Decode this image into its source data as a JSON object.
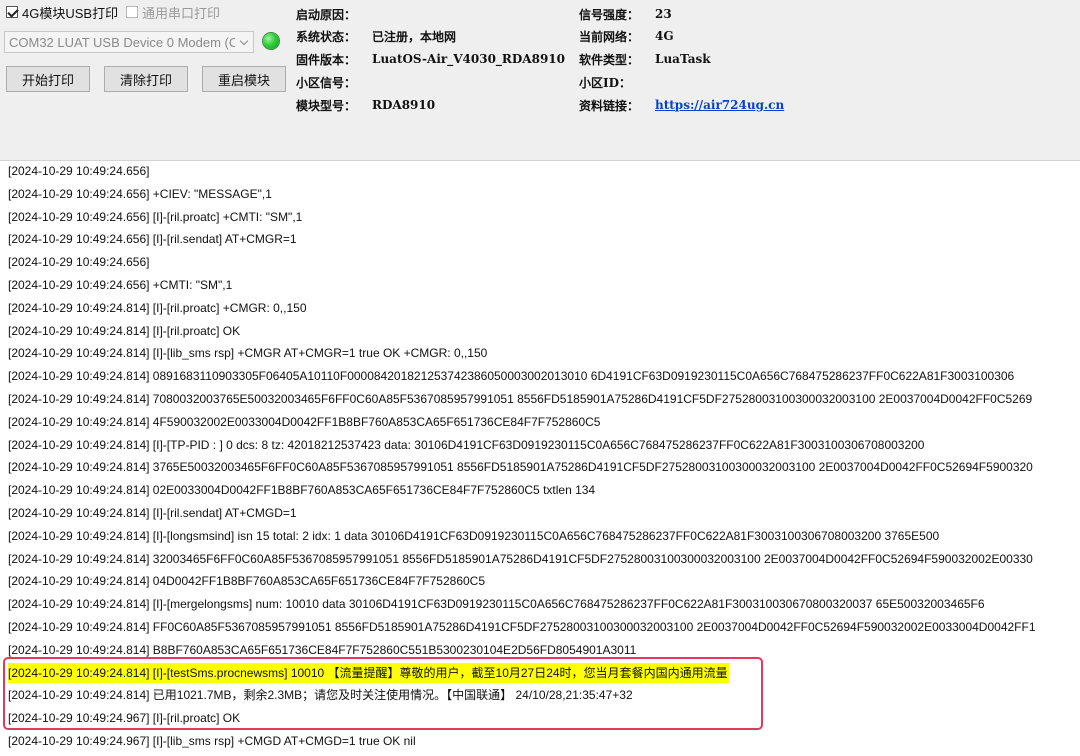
{
  "top": {
    "chk_4g": "4G模块USB打印",
    "chk_serial": "通用串口打印",
    "combo_value": "COM32 LUAT USB Device 0 Modem (C",
    "buttons": {
      "start": "开始打印",
      "clear": "清除打印",
      "restart": "重启模块"
    },
    "led_color": "#2ecf3a"
  },
  "info": {
    "boot_reason_label": "启动原因：",
    "boot_reason": "",
    "sys_status_label": "系统状态：",
    "sys_status": "已注册，本地网",
    "firmware_label": "固件版本：",
    "firmware": "LuatOS-Air_V4030_RDA8910",
    "cell_label": "小区信号：",
    "cell": "",
    "module_label": "模块型号：",
    "module": "RDA8910",
    "signal_label": "信号强度：",
    "signal": "23",
    "network_label": "当前网络：",
    "network": "4G",
    "software_label": "软件类型：",
    "software": "LuaTask",
    "cellid_label": "小区ID：",
    "cellid": "",
    "link_label": "资料链接：",
    "link": "https://air724ug.cn",
    "link_color": "#0a3fcf"
  },
  "log": [
    "[2024-10-29 10:49:24.656]",
    "[2024-10-29 10:49:24.656] +CIEV: \"MESSAGE\",1",
    "[2024-10-29 10:49:24.656] [I]-[ril.proatc] +CMTI: \"SM\",1",
    "[2024-10-29 10:49:24.656] [I]-[ril.sendat] AT+CMGR=1",
    "[2024-10-29 10:49:24.656]",
    "[2024-10-29 10:49:24.656] +CMTI: \"SM\",1",
    "[2024-10-29 10:49:24.814] [I]-[ril.proatc] +CMGR: 0,,150",
    "[2024-10-29 10:49:24.814] [I]-[ril.proatc] OK",
    "[2024-10-29 10:49:24.814] [I]-[lib_sms rsp] +CMGR AT+CMGR=1 true OK +CMGR: 0,,150",
    "[2024-10-29 10:49:24.814] 0891683110903305F06405A10110F000084201821253742386050003002013010 6D4191CF63D0919230115C0A656C768475286237FF0C622A81F3003100306",
    "[2024-10-29 10:49:24.814] 7080032003765E50032003465F6FF0C60A85F5367085957991051 8556FD5185901A75286D4191CF5DF27528003100300032003100 2E0037004D0042FF0C5269",
    "[2024-10-29 10:49:24.814] 4F590032002E0033004D0042FF1B8BF760A853CA65F651736CE84F7F752860C5",
    "[2024-10-29 10:49:24.814] [I]-[TP-PID : ] 0 dcs:  8 tz:  42018212537423 data:  30106D4191CF63D0919230115C0A656C768475286237FF0C622A81F3003100306708003200",
    "[2024-10-29 10:49:24.814] 3765E50032003465F6FF0C60A85F5367085957991051 8556FD5185901A75286D4191CF5DF27528003100300032003100 2E0037004D0042FF0C52694F5900320",
    "[2024-10-29 10:49:24.814] 02E0033004D0042FF1B8BF760A853CA65F651736CE84F7F752860C5 txtlen 134",
    "[2024-10-29 10:49:24.814] [I]-[ril.sendat] AT+CMGD=1",
    "[2024-10-29 10:49:24.814] [I]-[longsmsind] isn 15 total: 2 idx: 1 data 30106D4191CF63D0919230115C0A656C768475286237FF0C622A81F3003100306708003200 3765E500",
    "[2024-10-29 10:49:24.814] 32003465F6FF0C60A85F5367085957991051 8556FD5185901A75286D4191CF5DF27528003100300032003100 2E0037004D0042FF0C52694F590032002E00330",
    "[2024-10-29 10:49:24.814] 04D0042FF1B8BF760A853CA65F651736CE84F7F752860C5",
    "[2024-10-29 10:49:24.814] [I]-[mergelongsms] num: 10010 data 30106D4191CF63D0919230115C0A656C768475286237FF0C622A81F300310030670800320037 65E50032003465F6",
    "[2024-10-29 10:49:24.814] FF0C60A85F5367085957991051 8556FD5185901A75286D4191CF5DF27528003100300032003100 2E0037004D0042FF0C52694F590032002E0033004D0042FF1",
    "[2024-10-29 10:49:24.814] B8BF760A853CA65F651736CE84F7F752860C551B5300230104E2D56FD8054901A3011",
    "[2024-10-29 10:49:24.814] [I]-[testSms.procnewsms] 10010 【流量提醒】尊敬的用户，截至10月27日24时，您当月套餐内国内通用流量",
    "[2024-10-29 10:49:24.814] 已用1021.7MB，剩余2.3MB；请您及时关注使用情况。【中国联通】 24/10/28,21:35:47+32",
    "[2024-10-29 10:49:24.967] [I]-[ril.proatc] OK",
    "[2024-10-29 10:49:24.967] [I]-[lib_sms rsp] +CMGD AT+CMGD=1 true OK nil"
  ],
  "highlight_color": "#ffff00",
  "box_color": "#e03a5c"
}
